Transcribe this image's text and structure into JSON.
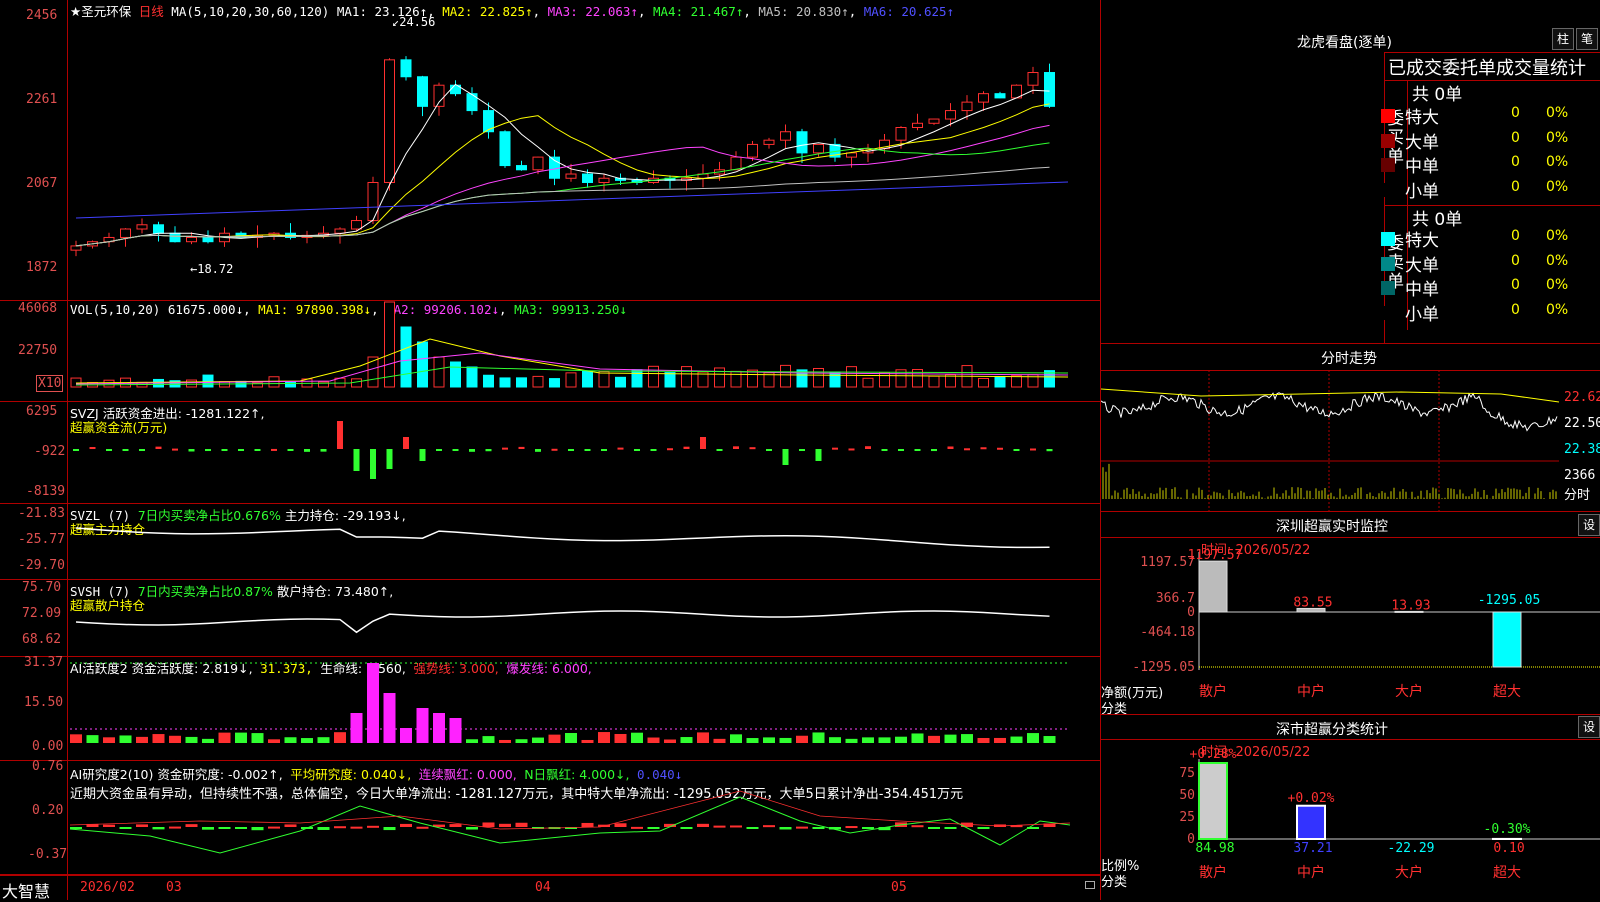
{
  "header": {
    "stock_name": "★圣元环保",
    "period": "日线",
    "ma_params": "MA(5,10,20,30,60,120)",
    "ma": [
      {
        "label": "MA1: 23.126↑",
        "color": "#ffffff"
      },
      {
        "label": "MA2: 22.825↑",
        "color": "#ffff00"
      },
      {
        "label": "MA3: 22.063↑",
        "color": "#ff44ff"
      },
      {
        "label": "MA4: 21.467↑",
        "color": "#30ff30"
      },
      {
        "label": "MA5: 20.830↑",
        "color": "#c0c0c0"
      },
      {
        "label": "MA6: 20.625↑",
        "color": "#4040ff"
      }
    ]
  },
  "price_axis": [
    "2456",
    "2261",
    "2067",
    "1872"
  ],
  "price_marks": {
    "high": "24.56",
    "low": "18.72"
  },
  "vol": {
    "header": "VOL(5,10,20)",
    "value": "61675.000↓",
    "ma1": "MA1: 97890.398↓",
    "ma2": "MA2: 99206.102↓",
    "ma3": "MA3: 99913.250↓",
    "axis": [
      "46068",
      "22750"
    ],
    "unit": "X10"
  },
  "svzj": {
    "header": "SVZJ  活跃资金进出: -1281.122↑,",
    "sub": "超赢资金流(万元)",
    "axis": [
      "6295",
      "-922",
      "-8139"
    ]
  },
  "svzl": {
    "header": "SVZL (7) ",
    "green": "7日内买卖净占比0.676%",
    "rest": " 主力持仓: -29.193↓,",
    "sub": "超赢主力持仓",
    "axis": [
      "-21.83",
      "-25.77",
      "-29.70"
    ]
  },
  "svsh": {
    "header": "SVSH (7) ",
    "green": "7日内买卖净占比0.87%",
    "rest": " 散户持仓: 73.480↑,",
    "sub": "超赢散户持仓",
    "axis": [
      "75.70",
      "72.09",
      "68.62"
    ]
  },
  "ai1": {
    "header": "AI活跃度2 资金活跃度: 2.819↓,",
    "v2": "31.373,",
    "v3": "生命线: 1.560,",
    "v4": "强势线: 3.000,",
    "v5": "爆发线: 6.000,",
    "axis": [
      "31.37",
      "15.50",
      "0.00"
    ]
  },
  "ai2": {
    "header": "AI研究度2(10) 资金研究度: -0.002↑,",
    "v2": "平均研究度: 0.040↓,",
    "v3": "连续飘红: 0.000,",
    "v4": "N日飘红: 4.000↓,",
    "v5": "0.040↓",
    "comment": "近期大资金虽有异动，但持续性不强，总体偏空，今日大单净流出: -1281.127万元，其中特大单净流出: -1295.052万元，大单5日累计净出-354.451万元",
    "axis": [
      "0.76",
      "0.20",
      "-0.37"
    ]
  },
  "time_axis": {
    "brand": "大智慧",
    "labels": [
      "2026/02",
      "03",
      "04",
      "05"
    ]
  },
  "dragon": {
    "title": "龙虎看盘(逐单)",
    "btn1": "柱",
    "btn2": "笔",
    "subtitle": "已成交委托单成交量统计",
    "buy": {
      "side": "委买单",
      "total": "共 0单",
      "rows": [
        {
          "name": "特大",
          "v": "0",
          "p": "0%",
          "color": "#ff0000"
        },
        {
          "name": "大单",
          "v": "0",
          "p": "0%",
          "color": "#990000"
        },
        {
          "name": "中单",
          "v": "0",
          "p": "0%",
          "color": "#660000"
        },
        {
          "name": "小单",
          "v": "0",
          "p": "0%",
          "color": "#000000"
        }
      ]
    },
    "sell": {
      "side": "委卖单",
      "total": "共 0单",
      "rows": [
        {
          "name": "特大",
          "v": "0",
          "p": "0%",
          "color": "#00ffff"
        },
        {
          "name": "大单",
          "v": "0",
          "p": "0%",
          "color": "#008888"
        },
        {
          "name": "中单",
          "v": "0",
          "p": "0%",
          "color": "#006666"
        },
        {
          "name": "小单",
          "v": "0",
          "p": "0%",
          "color": "#000000"
        }
      ]
    }
  },
  "intraday": {
    "title": "分时走势",
    "axis": [
      "22.62",
      "22.50",
      "22.38"
    ],
    "vol_label": "2366",
    "vol_unit": "分时"
  },
  "monitor": {
    "title": "深圳超赢实时监控",
    "btn": "设",
    "time": "时间: 2026/05/22",
    "axis": [
      "1197.57",
      "366.7",
      "0",
      "-464.18",
      "-1295.05"
    ],
    "ylabel": "净额(万元)",
    "xlabel": "分类",
    "bars": [
      {
        "cat": "散户",
        "val": "1197.57"
      },
      {
        "cat": "中户",
        "val": "83.55"
      },
      {
        "cat": "大户",
        "val": "13.93"
      },
      {
        "cat": "超大",
        "val": "-1295.05"
      }
    ]
  },
  "classify": {
    "title": "深市超赢分类统计",
    "btn": "设",
    "time": "时间: 2026/05/22",
    "axis": [
      "75",
      "50",
      "25",
      "0"
    ],
    "ylabel": "比例%",
    "xlabel": "分类",
    "top": [
      "+0.28%",
      "+0.02%",
      "-0.30%"
    ],
    "bars": [
      {
        "cat": "散户",
        "val": "84.98"
      },
      {
        "cat": "中户",
        "val": "37.21"
      },
      {
        "cat": "大户",
        "val": "-22.29"
      },
      {
        "cat": "超大",
        "val": "0.10"
      }
    ]
  }
}
